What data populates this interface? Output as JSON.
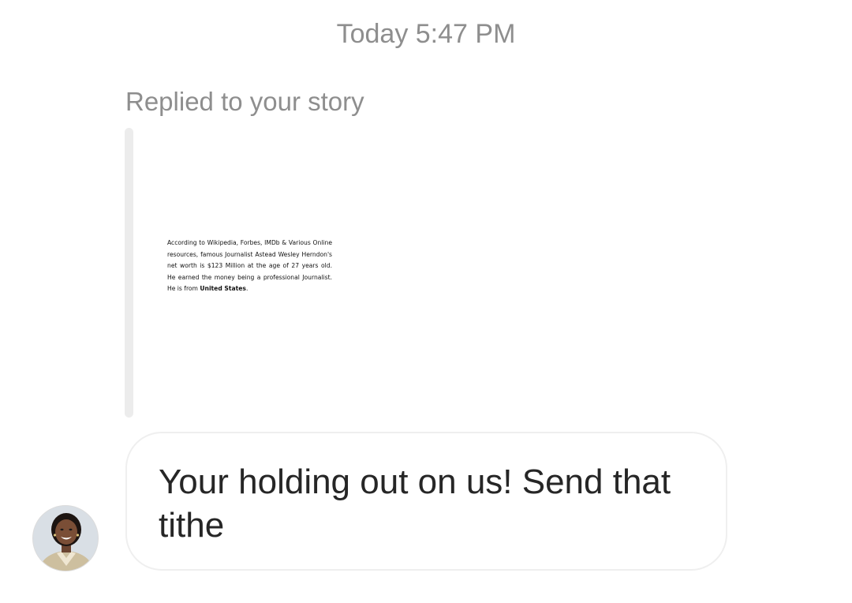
{
  "thread": {
    "timestamp": "Today 5:47 PM",
    "reply_label": "Replied to your story"
  },
  "story": {
    "text_lines": [
      "According to Wikipedia, Forbes, IMDb & Various Online resources, famous Journalist Astead Wesley Herndon's net worth is $123 Million at the age of 27 years old. He earned the money being a professional Journalist. He is from"
    ],
    "country": "United States",
    "trailing": "."
  },
  "message": {
    "text": "Your holding out on us! Send that tithe"
  },
  "sender": {
    "avatar_icon": "profile-photo-avatar"
  },
  "colors": {
    "meta_text": "#8e8e8e",
    "message_text": "#262626",
    "bubble_border": "#efefef",
    "story_bar": "#ececec"
  }
}
